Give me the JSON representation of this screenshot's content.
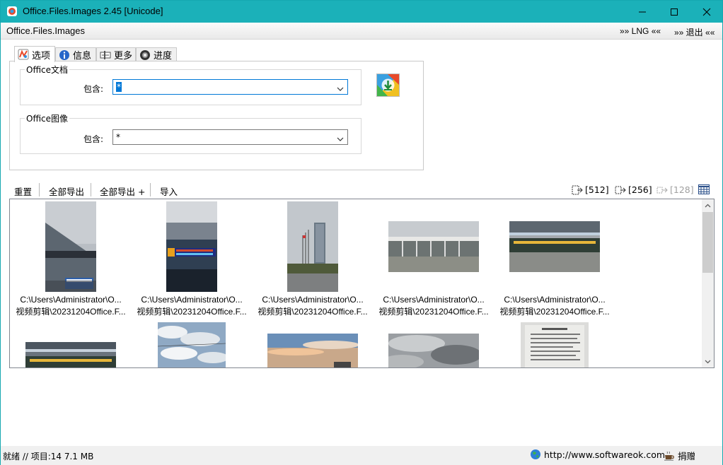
{
  "window": {
    "title": "Office.Files.Images 2.45 [Unicode]",
    "accent_color": "#1bb1b9"
  },
  "menubar": {
    "app_name": "Office.Files.Images",
    "lng": "»» LNG ««",
    "exit": "»» 退出 ««"
  },
  "tabs": [
    {
      "label": "选项",
      "icon": "options-icon"
    },
    {
      "label": "信息",
      "icon": "info-icon"
    },
    {
      "label": "更多",
      "icon": "more-icon"
    },
    {
      "label": "进度",
      "icon": "progress-icon"
    }
  ],
  "options": {
    "office_docs": {
      "legend": "Office文档",
      "label": "包含:",
      "value": "*"
    },
    "office_images": {
      "legend": "Office图像",
      "label": "包含:",
      "value": "*"
    }
  },
  "toolbar": {
    "reset": "重置",
    "export_all": "全部导出",
    "export_all_plus": "全部导出 +",
    "import": "导入",
    "size_512": "[512]",
    "size_256": "[256]",
    "size_128": "[128]"
  },
  "images": [
    {
      "line1": "C:\\Users\\Administrator\\O...",
      "line2": "视频剪辑\\20231204Office.F..."
    },
    {
      "line1": "C:\\Users\\Administrator\\O...",
      "line2": "视频剪辑\\20231204Office.F..."
    },
    {
      "line1": "C:\\Users\\Administrator\\O...",
      "line2": "视频剪辑\\20231204Office.F..."
    },
    {
      "line1": "C:\\Users\\Administrator\\O...",
      "line2": "视频剪辑\\20231204Office.F..."
    },
    {
      "line1": "C:\\Users\\Administrator\\O...",
      "line2": "视频剪辑\\20231204Office.F..."
    }
  ],
  "statusbar": {
    "status": "就绪 // 项目:14 7.1 MB",
    "url": "http://www.softwareok.com",
    "donate": "捐赠"
  }
}
